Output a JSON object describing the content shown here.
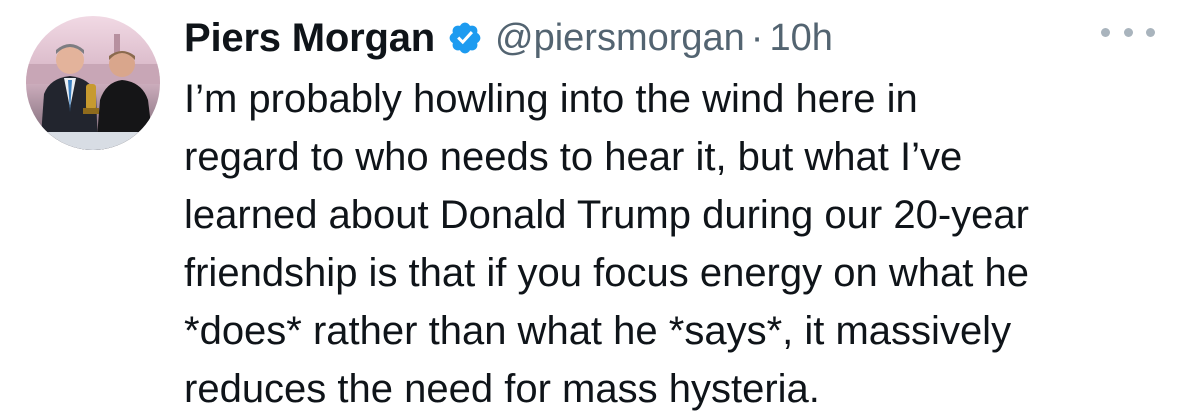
{
  "tweet": {
    "author_name": "Piers Morgan",
    "handle": "@piersmorgan",
    "separator": "·",
    "timestamp": "10h",
    "verified": true,
    "verified_icon": "verified-badge-icon",
    "more_icon": "more-options-icon",
    "avatar": "profile-photo",
    "text_lines": [
      "I’m probably howling into the wind here in",
      "regard to who needs to hear it, but what I’ve",
      "learned about Donald Trump during our 20-year",
      "friendship is that if you focus energy on what he",
      "*does* rather than what he *says*, it massively",
      "reduces the need for mass hysteria."
    ]
  },
  "colors": {
    "text": "#0f1419",
    "secondary": "#536471",
    "verified_blue": "#1d9bf0",
    "more_dots": "#a9b4bd"
  }
}
